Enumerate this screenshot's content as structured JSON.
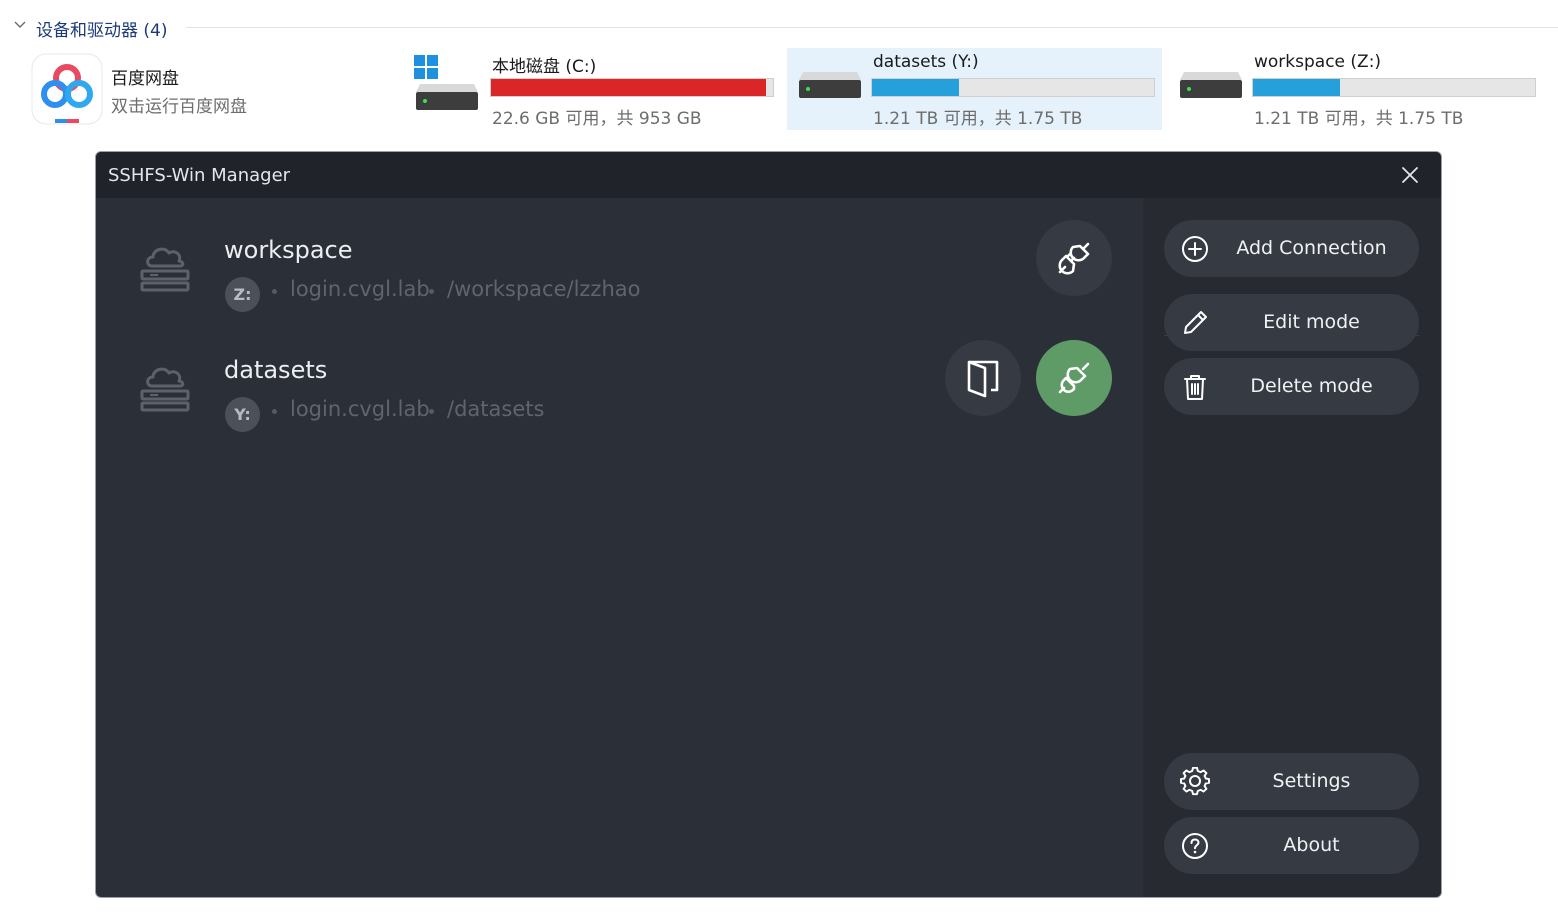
{
  "explorer": {
    "section_title": "设备和驱动器 (4)",
    "items": [
      {
        "name": "百度网盘",
        "subtitle": "双击运行百度网盘",
        "icon": "baidu-netdisk-icon"
      },
      {
        "name": "本地磁盘 (C:)",
        "space_text": "22.6 GB 可用，共 953 GB",
        "used_fraction": 0.976,
        "bar_color": "#da2626",
        "icon": "windows-drive-icon"
      },
      {
        "name": "datasets (Y:)",
        "space_text": "1.21 TB 可用，共 1.75 TB",
        "used_fraction": 0.309,
        "bar_color": "#26a0da",
        "icon": "network-drive-icon",
        "selected": true
      },
      {
        "name": "workspace (Z:)",
        "space_text": "1.21 TB 可用，共 1.75 TB",
        "used_fraction": 0.309,
        "bar_color": "#26a0da",
        "icon": "network-drive-icon"
      }
    ]
  },
  "dialog": {
    "title": "SSHFS-Win Manager",
    "close_icon": "close-icon",
    "connections": [
      {
        "name": "workspace",
        "drive": "Z:",
        "host": "login.cvgl.lab",
        "path": "/workspace/lzzhao",
        "connected": false,
        "icon": "cloud-server-icon"
      },
      {
        "name": "datasets",
        "drive": "Y:",
        "host": "login.cvgl.lab",
        "path": "/datasets",
        "connected": true,
        "icon": "cloud-server-icon"
      }
    ],
    "sidebar": {
      "add_connection": "Add Connection",
      "edit_mode": "Edit mode",
      "delete_mode": "Delete mode",
      "settings": "Settings",
      "about": "About"
    },
    "colors": {
      "connected": "#5f9b66",
      "background": "#2b2f38",
      "titlebar": "#20232a"
    }
  }
}
